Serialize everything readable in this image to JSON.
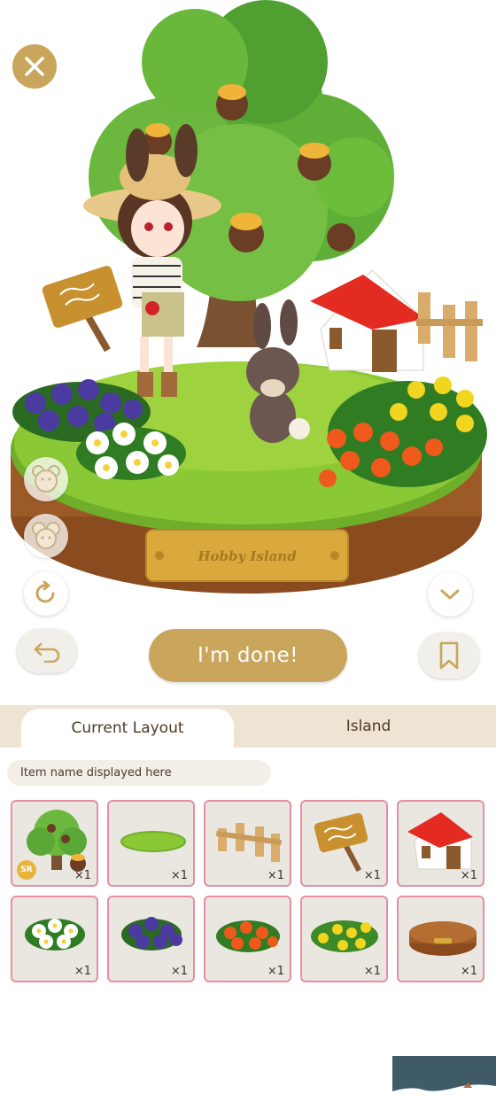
{
  "scene": {
    "plate_text": "Hobby Island"
  },
  "buttons": {
    "done_label": "I'm done!"
  },
  "tabs": [
    {
      "label": "Current Layout"
    },
    {
      "label": "Island"
    }
  ],
  "item_name_placeholder": "Item name displayed here",
  "inventory": [
    {
      "name": "tree",
      "qty": "×1",
      "rarity": "SR"
    },
    {
      "name": "grass-patch",
      "qty": "×1"
    },
    {
      "name": "wooden-fence",
      "qty": "×1"
    },
    {
      "name": "signpost",
      "qty": "×1"
    },
    {
      "name": "red-roof-house",
      "qty": "×1"
    },
    {
      "name": "white-flowers",
      "qty": "×1"
    },
    {
      "name": "purple-flowers",
      "qty": "×1"
    },
    {
      "name": "orange-flowers",
      "qty": "×1"
    },
    {
      "name": "yellow-flowers",
      "qty": "×1"
    },
    {
      "name": "island-base",
      "qty": "×1"
    }
  ],
  "colors": {
    "accent_gold": "#c9a65c",
    "tab_bg": "#efe4d3",
    "slot_border": "#e58ea4",
    "slot_bg": "#eae7e1"
  }
}
